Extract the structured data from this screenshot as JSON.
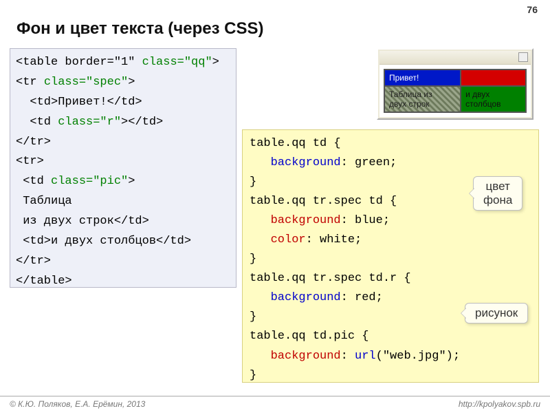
{
  "page_number": "76",
  "title": "Фон и цвет текста (через CSS)",
  "html_code": {
    "l1a": "<table border=\"1\" ",
    "l1b": "class=\"qq\"",
    "l1c": ">",
    "l2a": "<tr ",
    "l2b": "class=\"spec\"",
    "l2c": ">",
    "l3": "  <td>Привет!</td>",
    "l4a": "  <td ",
    "l4b": "class=\"r\"",
    "l4c": "></td>",
    "l5": "</tr>",
    "l6": "<tr>",
    "l7a": " <td ",
    "l7b": "class=\"pic\"",
    "l7c": ">",
    "l8": " Таблица",
    "l9": " из двух строк</td>",
    "l10": " <td>и двух столбцов</td>",
    "l11": "</tr>",
    "l12": "</table>"
  },
  "css_code": {
    "r1": "table.qq td {",
    "r2a": "   background",
    "r2b": ": green;",
    "r3": "}",
    "r4": "table.qq tr.spec td {",
    "r5a": "   background",
    "r5b": ": blue;",
    "r6a": "   color",
    "r6b": ": white;",
    "r7": "}",
    "r8": "table.qq tr.spec td.r {",
    "r9a": "   background",
    "r9b": ": red;",
    "r10": "}",
    "r11": "table.qq td.pic {",
    "r12a": "   background",
    "r12b": ": ",
    "r12c": "url",
    "r12d": "(\"web.jpg\");",
    "r13": "}"
  },
  "preview": {
    "cell_tl": "Привет!",
    "cell_bl_line1": "Таблица из",
    "cell_bl_line2": "двух строк",
    "cell_br_line1": "и двух",
    "cell_br_line2": "столбцов"
  },
  "callouts": {
    "bg_line1": "цвет",
    "bg_line2": "фона",
    "pic": "рисунок"
  },
  "footer_left": "© К.Ю. Поляков, Е.А. Ерёмин, 2013",
  "footer_right": "http://kpolyakov.spb.ru"
}
